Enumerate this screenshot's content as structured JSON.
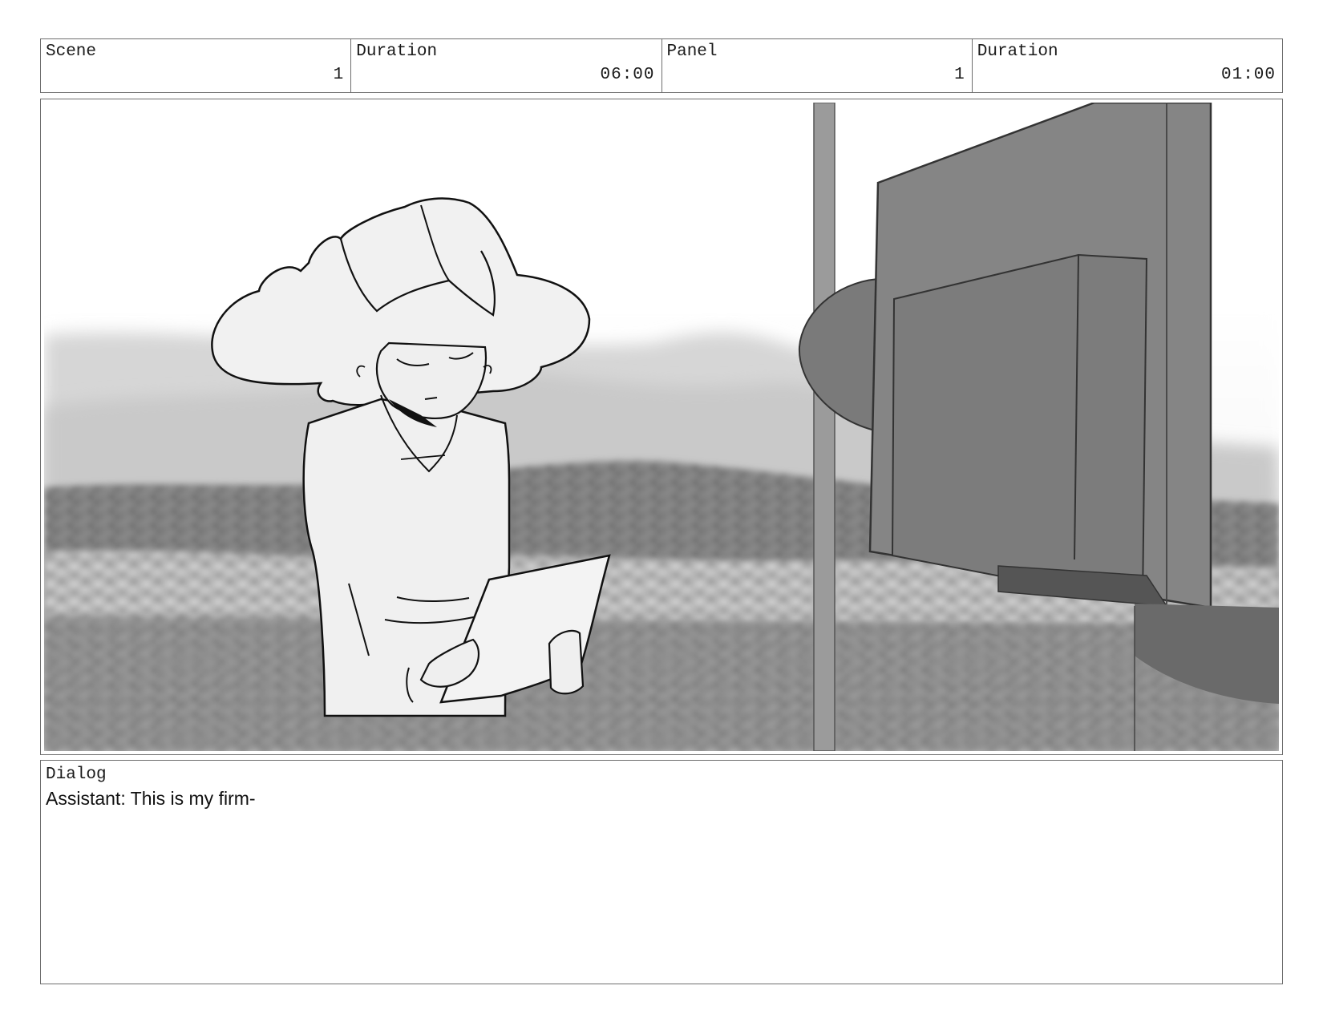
{
  "header": {
    "scene_label": "Scene",
    "scene_value": "1",
    "scene_duration_label": "Duration",
    "scene_duration_value": "06:00",
    "panel_label": "Panel",
    "panel_value": "1",
    "panel_duration_label": "Duration",
    "panel_duration_value": "01:00"
  },
  "dialog": {
    "label": "Dialog",
    "text": "Assistant: This is my firm-"
  }
}
